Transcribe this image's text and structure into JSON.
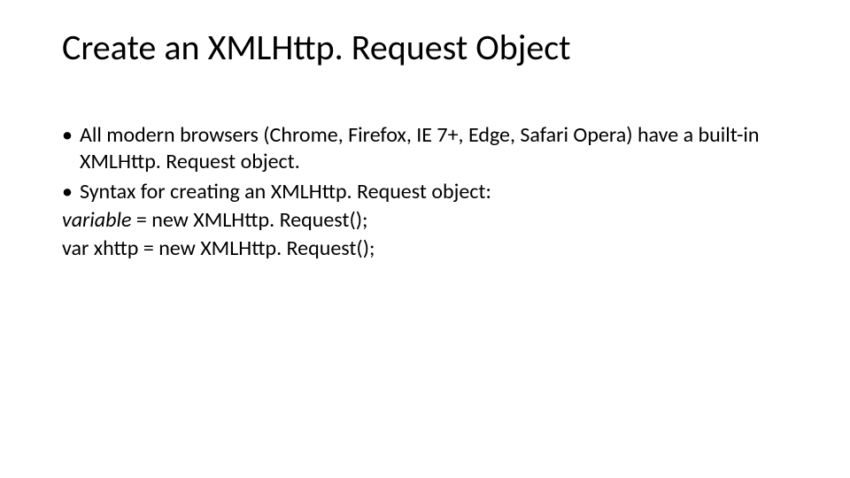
{
  "slide": {
    "title": "Create an XMLHttp. Request Object",
    "bullets": [
      "All modern browsers (Chrome, Firefox, IE 7+, Edge, Safari Opera) have a built-in XMLHttp. Request object.",
      "Syntax for creating an XMLHttp. Request object:"
    ],
    "code": {
      "line1_var": "variable",
      "line1_rest": " = new XMLHttp. Request();",
      "line2": "var xhttp = new XMLHttp. Request();"
    }
  }
}
